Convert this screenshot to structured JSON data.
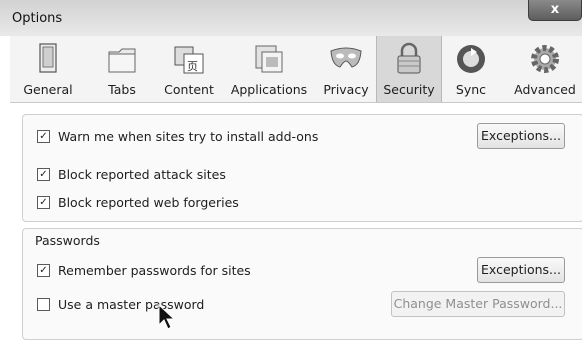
{
  "window": {
    "title": "Options",
    "close_glyph": "x"
  },
  "toolbar": {
    "items": [
      {
        "label": "General",
        "icon": "general-icon"
      },
      {
        "label": "Tabs",
        "icon": "tabs-icon"
      },
      {
        "label": "Content",
        "icon": "content-icon"
      },
      {
        "label": "Applications",
        "icon": "applications-icon"
      },
      {
        "label": "Privacy",
        "icon": "privacy-mask-icon"
      },
      {
        "label": "Security",
        "icon": "security-lock-icon",
        "selected": true
      },
      {
        "label": "Sync",
        "icon": "sync-icon"
      },
      {
        "label": "Advanced",
        "icon": "advanced-gear-icon"
      }
    ]
  },
  "addons": {
    "warn_label": "Warn me when sites try to install add-ons",
    "warn_checked": "✓",
    "exceptions_label": "Exceptions...",
    "attack_label": "Block reported attack sites",
    "attack_checked": "✓",
    "forgeries_label": "Block reported web forgeries",
    "forgeries_checked": "✓"
  },
  "passwords": {
    "section_label": "Passwords",
    "remember_label": "Remember passwords for sites",
    "remember_checked": "✓",
    "exceptions_label": "Exceptions...",
    "master_label": "Use a master password",
    "master_checked": "",
    "change_master_label": "Change Master Password..."
  },
  "colors": {
    "selected_tab": "#d8d8d8",
    "toolbar_bg": "#f4f4f4"
  }
}
